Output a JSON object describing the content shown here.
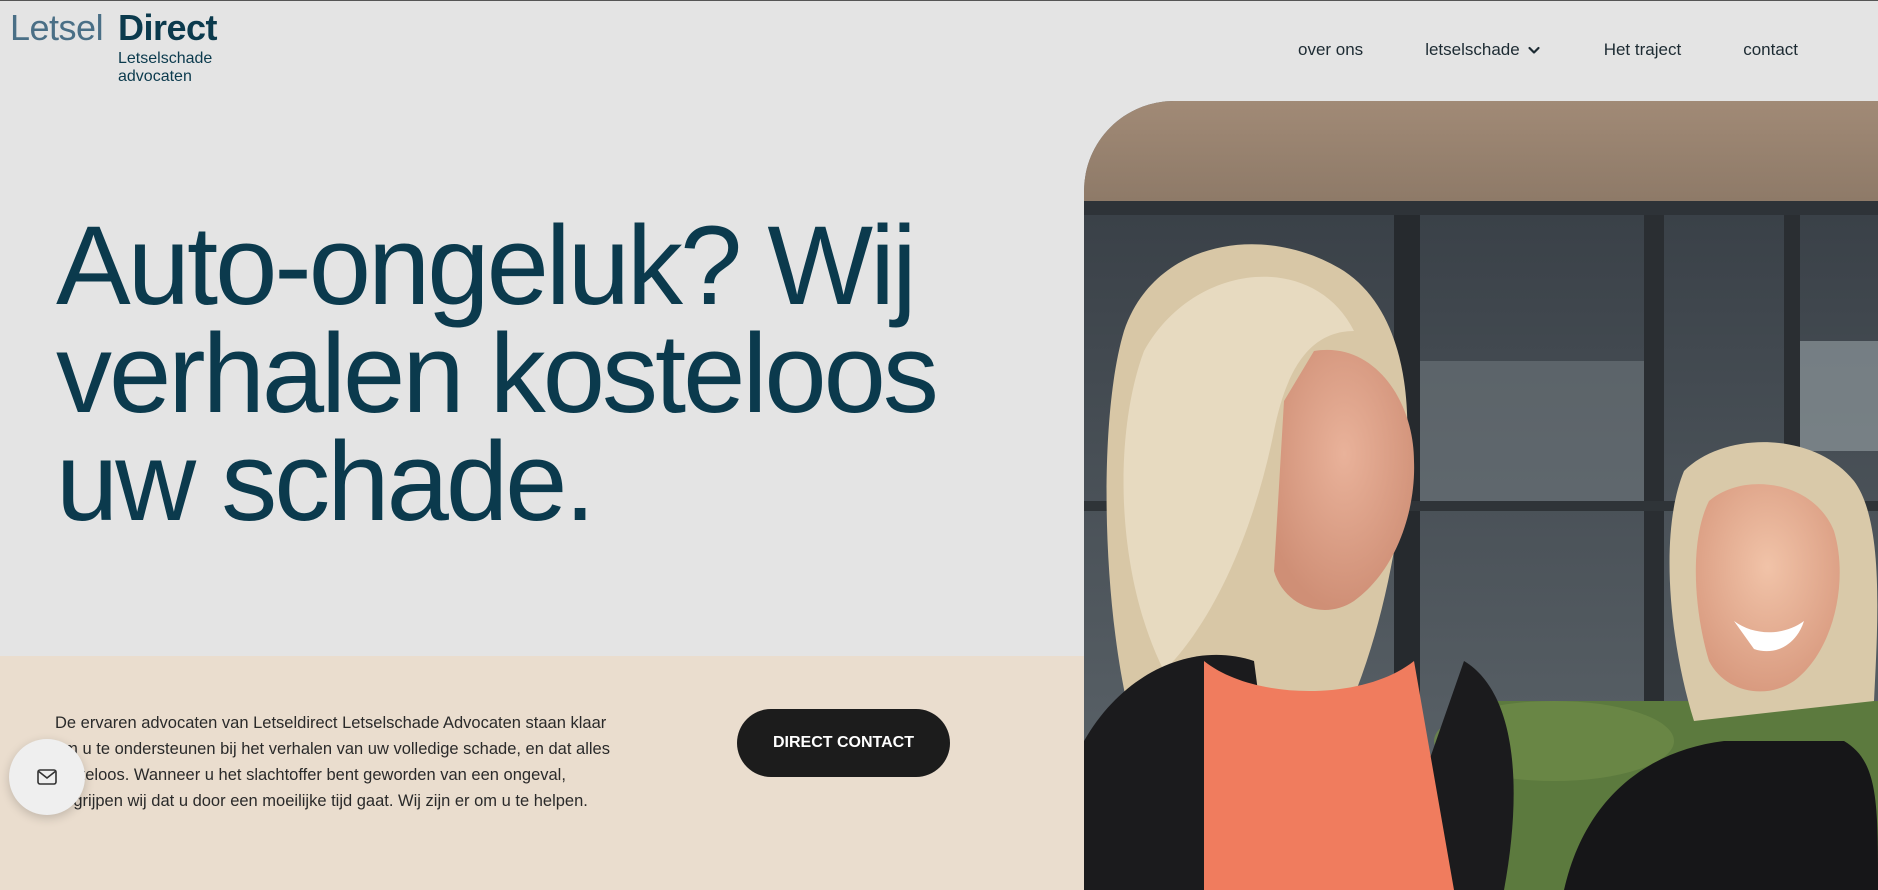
{
  "logo": {
    "word_left": "Letsel",
    "word_right": "Direct",
    "subtitle_line1": "Letselschade",
    "subtitle_line2": "advocaten"
  },
  "nav": {
    "items": [
      {
        "label": "over ons"
      },
      {
        "label": "letselschade",
        "has_dropdown": true
      },
      {
        "label": "Het traject"
      },
      {
        "label": "contact"
      }
    ]
  },
  "hero": {
    "headline_line1": "Auto-ongeluk? Wij",
    "headline_line2": "verhalen kosteloos",
    "headline_line3": "uw schade.",
    "description": "De ervaren advocaten van Letseldirect Letselschade Advocaten staan klaar om u te ondersteunen bij het verhalen van uw volledige schade, en dat alles kosteloos. Wanneer u het slachtoffer bent geworden van een ongeval, begrijpen wij dat u door een moeilijke tijd gaat. Wij zijn er om u te helpen.",
    "cta_label": "DIRECT CONTACT"
  },
  "icons": {
    "mail": "mail-icon",
    "chevron": "chevron-down-icon"
  },
  "colors": {
    "brand_dark": "#0b3a4d",
    "brand_light": "#4a6f86",
    "page_bg": "#e4e4e4",
    "band_bg": "#eaddce",
    "cta_bg": "#1c1c1c"
  }
}
